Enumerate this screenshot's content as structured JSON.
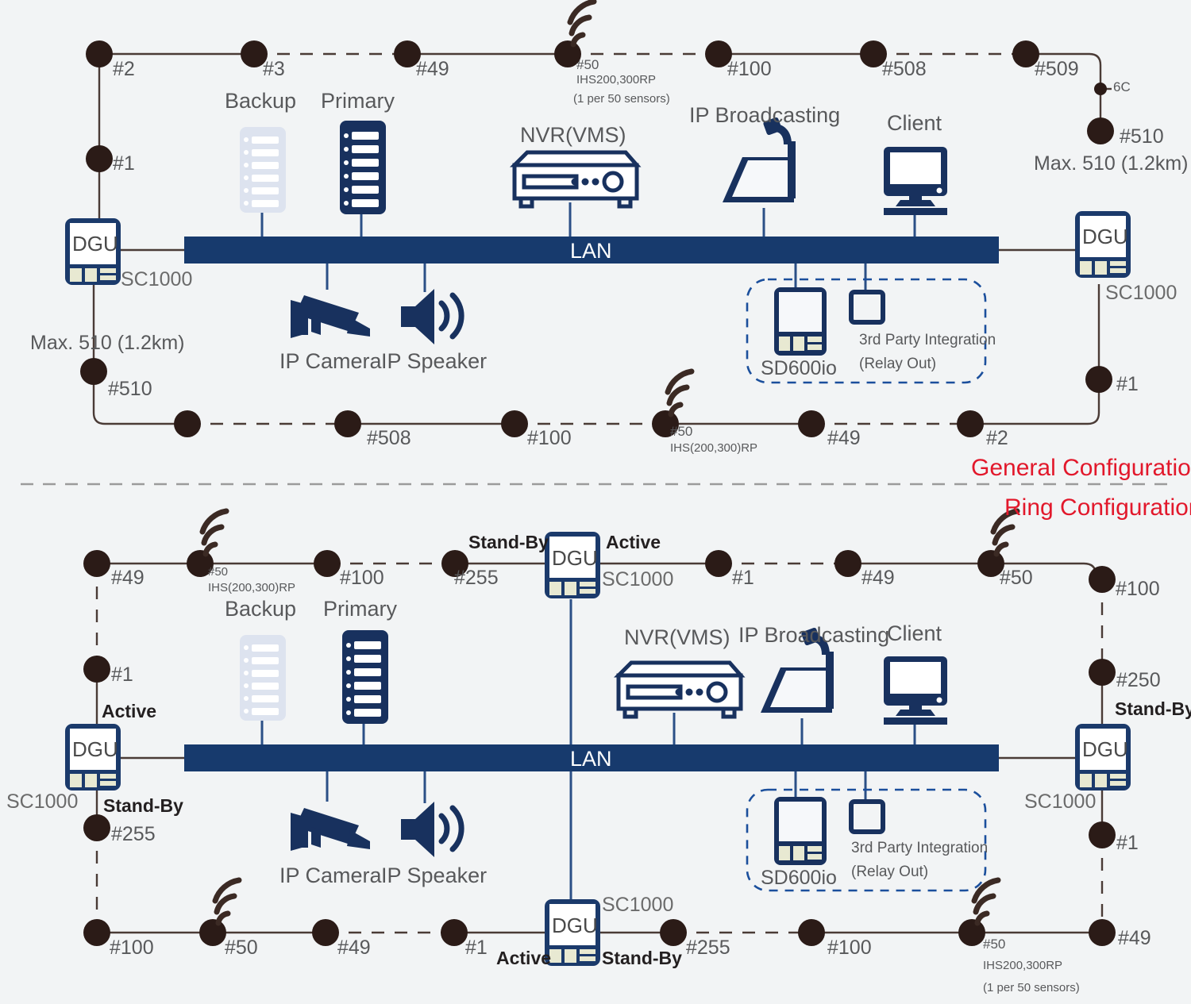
{
  "meta": {
    "colors": {
      "background": "#f2f4f5",
      "node": "#2b1b17",
      "line": "#4a3b36",
      "navy": "#1b3a6b",
      "lan": "#173a6d",
      "accent_red": "#e2182b",
      "backup_gray": "#dde3ef",
      "dashed_box": "#1b4f9c"
    }
  },
  "sections": {
    "general_label": "General Configuration",
    "ring_label": "Ring Configuration"
  },
  "devices": {
    "backup": "Backup",
    "primary": "Primary",
    "nvr": "NVR(VMS)",
    "ip_broadcasting": "IP Broadcasting",
    "client": "Client",
    "ip_camera": "IP Camera",
    "ip_speaker": "IP Speaker",
    "lan": "LAN",
    "dgu": "DGU",
    "sc1000": "SC1000",
    "sd600io": "SD600io",
    "third_party": "3rd Party Integration",
    "relay_out": "(Relay Out)"
  },
  "general": {
    "top_nodes": [
      "#2",
      "#3",
      "#49",
      "#50",
      "#100",
      "#508",
      "#509"
    ],
    "top_sensor_label": "IHS200,300RP",
    "top_sensor_note": "(1 per 50 sensors)",
    "tap_label": "6C",
    "right_end_node": "#510",
    "right_max": "Max. 510 (1.2km)",
    "left_node": "#1",
    "left_max": "Max. 510 (1.2km)",
    "left_end_node": "#510",
    "bottom_nodes": [
      "#508",
      "#100",
      "#50",
      "#49",
      "#2"
    ],
    "bottom_sensor_label": "IHS(200,300)RP",
    "right_dgu_node": "#1"
  },
  "ring": {
    "top_left_nodes": [
      "#49",
      "#50",
      "#100",
      "#255"
    ],
    "top_sensor_label": "IHS(200,300)RP",
    "center_standby": "Stand-By",
    "center_active": "Active",
    "top_right_nodes": [
      "#1",
      "#49",
      "#50",
      "#100"
    ],
    "left_col_nodes": [
      "#1",
      "#255"
    ],
    "left_active": "Active",
    "left_standby": "Stand-By",
    "right_col_nodes": [
      "#250",
      "#1"
    ],
    "right_standby": "Stand-By",
    "bottom_nodes": [
      "#100",
      "#50",
      "#49",
      "#1",
      "#255",
      "#100",
      "#50",
      "#49"
    ],
    "bottom_active": "Active",
    "bottom_standby": "Stand-By",
    "bottom_sensor_label": "IHS200,300RP",
    "bottom_sensor_note": "(1 per 50 sensors)"
  }
}
